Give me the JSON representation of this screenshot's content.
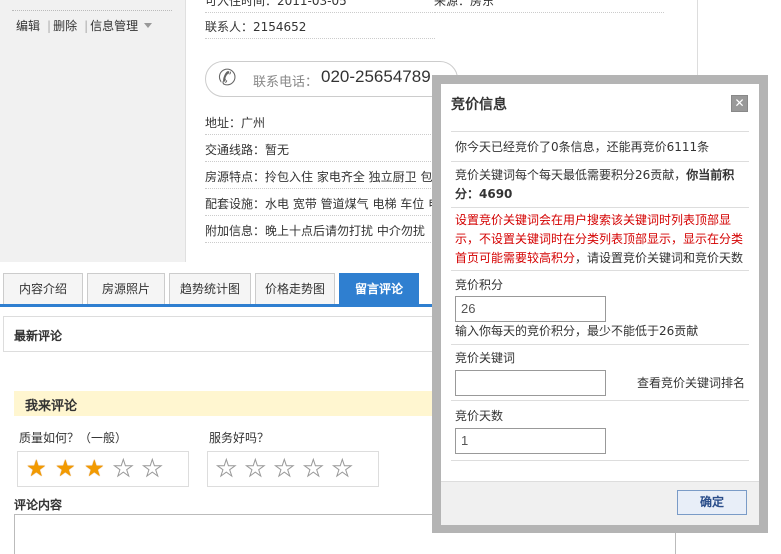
{
  "left_panel": {
    "actions": [
      {
        "label": "编辑"
      },
      {
        "label": "删除"
      },
      {
        "label": "信息管理"
      }
    ]
  },
  "info": {
    "top_left_partial": "可入住时间：2011-03-05",
    "top_right_partial": "来源：房东",
    "contact_person": "联系人：2154652",
    "phone_label": "联系电话：",
    "phone_number": "020-25654789",
    "rows": [
      "地址：广州",
      "交通线路：暂无",
      "房源特点：拎包入住 家电齐全 独立厨卫 包物",
      "配套设施：水电 宽带 管道煤气 电梯 车位 电话",
      "附加信息：晚上十点后请勿打扰 中介勿扰"
    ]
  },
  "tabs": [
    {
      "label": "内容介绍"
    },
    {
      "label": "房源照片"
    },
    {
      "label": "趋势统计图"
    },
    {
      "label": "价格走势图"
    },
    {
      "label": "留言评论",
      "active": true
    }
  ],
  "comments": {
    "latest_title": "最新评论",
    "my_comment_title": "我来评论",
    "quality_label": "质量如何？（一般）",
    "quality_rating": 3,
    "service_label": "服务好吗？",
    "service_rating": 0,
    "content_label": "评论内容"
  },
  "dialog": {
    "title": "竞价信息",
    "close_glyph": "✕",
    "line1": "你今天已经竞价了0条信息，还能再竞价6111条",
    "line2_prefix": "竞价关键词每个每天最低需要积分26贡献，",
    "line2_bold": "你当前积分：4690",
    "red_text": "设置竞价关键词会在用户搜索该关键词时列表顶部显示，不设置关键词时在分类列表顶部显示，显示在分类首页可能需要较高积分",
    "red_suffix": "，请设置竞价关键词和竞价天数",
    "points_label": "竞价积分",
    "points_value": "26",
    "points_hint": "输入你每天的竞价积分，最少不能低于26贡献",
    "keyword_label": "竞价关键词",
    "keyword_value": "",
    "keyword_rank_link": "查看竞价关键词排名",
    "days_label": "竞价天数",
    "days_value": "1",
    "ok_label": "确定"
  },
  "colors": {
    "accent_blue": "#2f7fd0",
    "star_on": "#f29a00",
    "warning_red": "#d40000",
    "highlight_yellow": "#fff6d0"
  }
}
